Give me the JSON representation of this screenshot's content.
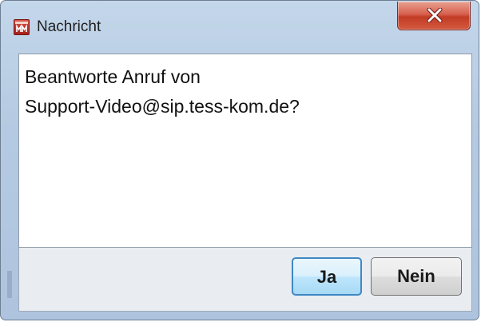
{
  "window": {
    "title": "Nachricht",
    "icon": "app-logo-icon"
  },
  "titlebar": {
    "close_icon": "close-icon"
  },
  "message": {
    "line1": "Beantworte Anruf von",
    "line2": "Support-Video@sip.tess-kom.de?"
  },
  "buttons": {
    "yes_label": "Ja",
    "no_label": "Nein"
  },
  "colors": {
    "title_bar": "#b5cae2",
    "close_button": "#c9472f",
    "default_button_border": "#3f88c5",
    "button_bar": "#e9ecf0"
  }
}
